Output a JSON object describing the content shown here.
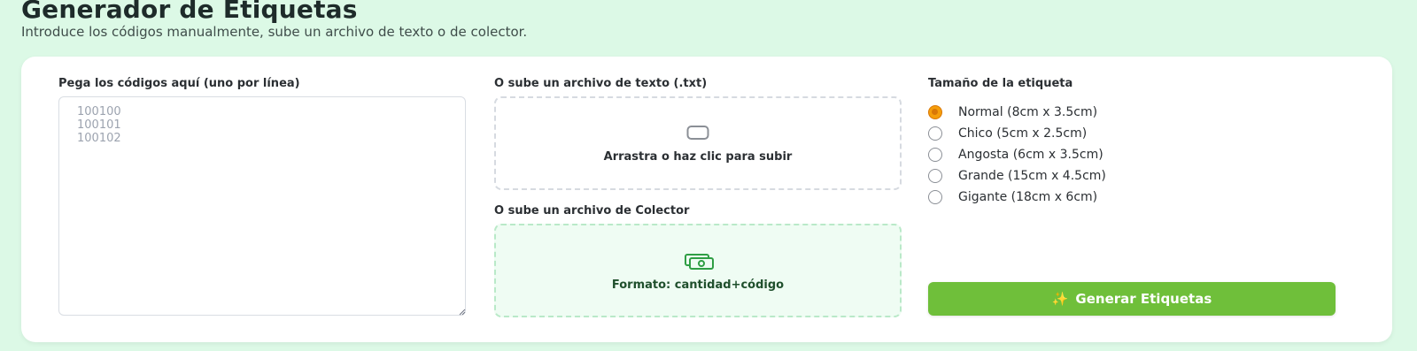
{
  "header": {
    "title": "Generador de Etiquetas",
    "subtitle": "Introduce los códigos manualmente, sube un archivo de texto o de colector."
  },
  "manual": {
    "label": "Pega los códigos aquí (uno por línea)",
    "placeholder": "100100\n100101\n100102",
    "value": ""
  },
  "upload_txt": {
    "label": "O sube un archivo de texto (.txt)",
    "icon": "document-icon",
    "text": "Arrastra o haz clic para subir"
  },
  "upload_collector": {
    "label": "O sube un archivo de Colector",
    "icon": "cash-icon",
    "text": "Formato: cantidad+código"
  },
  "size": {
    "label": "Tamaño de la etiqueta",
    "options": [
      {
        "label": "Normal (8cm x 3.5cm)",
        "checked": true
      },
      {
        "label": "Chico (5cm x 2.5cm)",
        "checked": false
      },
      {
        "label": "Angosta (6cm x 3.5cm)",
        "checked": false
      },
      {
        "label": "Grande (15cm x 4.5cm)",
        "checked": false
      },
      {
        "label": "Gigante (18cm x 6cm)",
        "checked": false
      }
    ]
  },
  "actions": {
    "generate_icon": "sparkles-icon",
    "generate_label": "Generar Etiquetas"
  },
  "colors": {
    "background": "#dcf9e6",
    "card": "#ffffff",
    "accent_green": "#6fbf3a",
    "radio_checked": "#f59e0b",
    "collector_zone": "#effcf3"
  }
}
